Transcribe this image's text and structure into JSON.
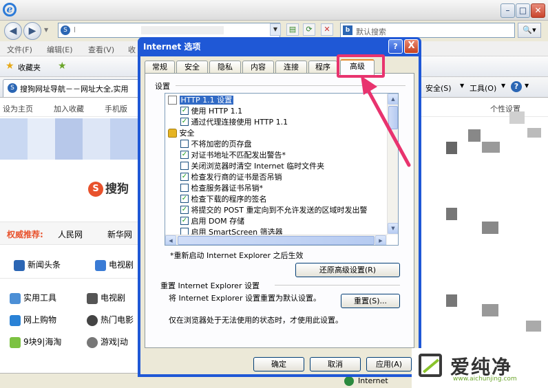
{
  "ie": {
    "logo": "e",
    "address_text": "l",
    "search_placeholder": "默认搜索",
    "search_brand": "b",
    "menu": [
      "文件(F)",
      "编辑(E)",
      "查看(V)",
      "收"
    ],
    "favorites_label": "收藏夹",
    "tab_title": "搜狗网址导航－－网址大全,实用",
    "toolbar": {
      "safety": "安全(S)",
      "tools": "工具(O)",
      "help": "?"
    },
    "status_zone": "Internet"
  },
  "page": {
    "links_left": [
      "设为主页",
      "加入收藏",
      "手机版"
    ],
    "personal_settings": "个性设置",
    "logo_text": "搜狗",
    "authority_label": "权威推荐:",
    "authority_links": [
      "人民网",
      "新华网"
    ],
    "news_tabs": [
      "新闻头条",
      "电视剧"
    ],
    "site_grid": [
      [
        "实用工具",
        "电视剧"
      ],
      [
        "网上购物",
        "热门电影"
      ],
      [
        "9块9|海淘",
        "游戏|动"
      ]
    ]
  },
  "dialog": {
    "title": "Internet 选项",
    "help": "?",
    "close": "X",
    "tabs": [
      "常规",
      "安全",
      "隐私",
      "内容",
      "连接",
      "程序",
      "高级"
    ],
    "active_tab": "高级",
    "settings_label": "设置",
    "tree": [
      {
        "type": "category",
        "icon": "document-icon",
        "label": "HTTP 1.1 设置",
        "selected": true
      },
      {
        "type": "checkbox",
        "checked": true,
        "label": "使用 HTTP 1.1"
      },
      {
        "type": "checkbox",
        "checked": true,
        "label": "通过代理连接使用 HTTP 1.1"
      },
      {
        "type": "category",
        "icon": "lock-icon",
        "label": "安全"
      },
      {
        "type": "checkbox",
        "checked": false,
        "label": "不将加密的页存盘"
      },
      {
        "type": "checkbox",
        "checked": true,
        "label": "对证书地址不匹配发出警告*"
      },
      {
        "type": "checkbox",
        "checked": false,
        "label": "关闭浏览器时清空 Internet 临时文件夹"
      },
      {
        "type": "checkbox",
        "checked": true,
        "label": "检查发行商的证书是否吊销"
      },
      {
        "type": "checkbox",
        "checked": false,
        "label": "检查服务器证书吊销*"
      },
      {
        "type": "checkbox",
        "checked": true,
        "label": "检查下载的程序的签名"
      },
      {
        "type": "checkbox",
        "checked": true,
        "label": "将提交的 POST 重定向到不允许发送的区域时发出警"
      },
      {
        "type": "checkbox",
        "checked": true,
        "label": "启用 DOM 存储"
      },
      {
        "type": "checkbox",
        "checked": false,
        "label": "启用 SmartScreen 筛选器"
      }
    ],
    "restart_note": "*重新启动 Internet Explorer 之后生效",
    "restore_button": "还原高级设置(R)",
    "reset_title": "重置 Internet Explorer 设置",
    "reset_desc": "将 Internet Explorer 设置重置为默认设置。",
    "reset_button": "重置(S)...",
    "reset_note": "仅在浏览器处于无法使用的状态时，才使用此设置。",
    "ok": "确定",
    "cancel": "取消",
    "apply": "应用(A)"
  },
  "watermark": {
    "text": "爱纯净",
    "url": "www.aichunjing.com"
  },
  "colors": {
    "title_blue": "#1f58d6",
    "highlight": "#e8336e",
    "check_green": "#21a121"
  }
}
